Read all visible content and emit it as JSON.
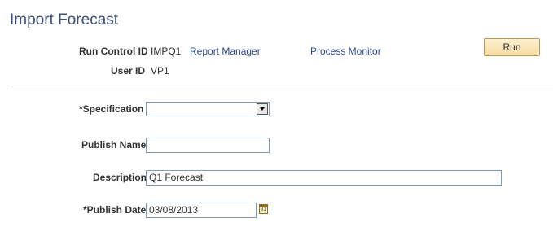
{
  "page": {
    "title": "Import Forecast"
  },
  "header": {
    "run_control_label": "Run Control ID",
    "run_control_value": "IMPQ1",
    "report_manager_link": "Report Manager",
    "process_monitor_link": "Process Monitor",
    "run_button": "Run",
    "user_id_label": "User ID",
    "user_id_value": "VP1"
  },
  "form": {
    "specification_label": "*Specification",
    "specification_value": "",
    "publish_name_label": "Publish Name",
    "publish_name_value": "",
    "description_label": "Description",
    "description_value": "Q1 Forecast",
    "publish_date_label": "*Publish Date",
    "publish_date_value": "03/08/2013",
    "calendar_icon_text": "31"
  },
  "colors": {
    "title": "#3a4f7a",
    "link": "#2a4a8c",
    "button_bg": "#f5dca0",
    "input_border": "#7f9db9"
  },
  "icons": {
    "calendar": "calendar-icon",
    "dropdown": "chevron-down-icon"
  }
}
